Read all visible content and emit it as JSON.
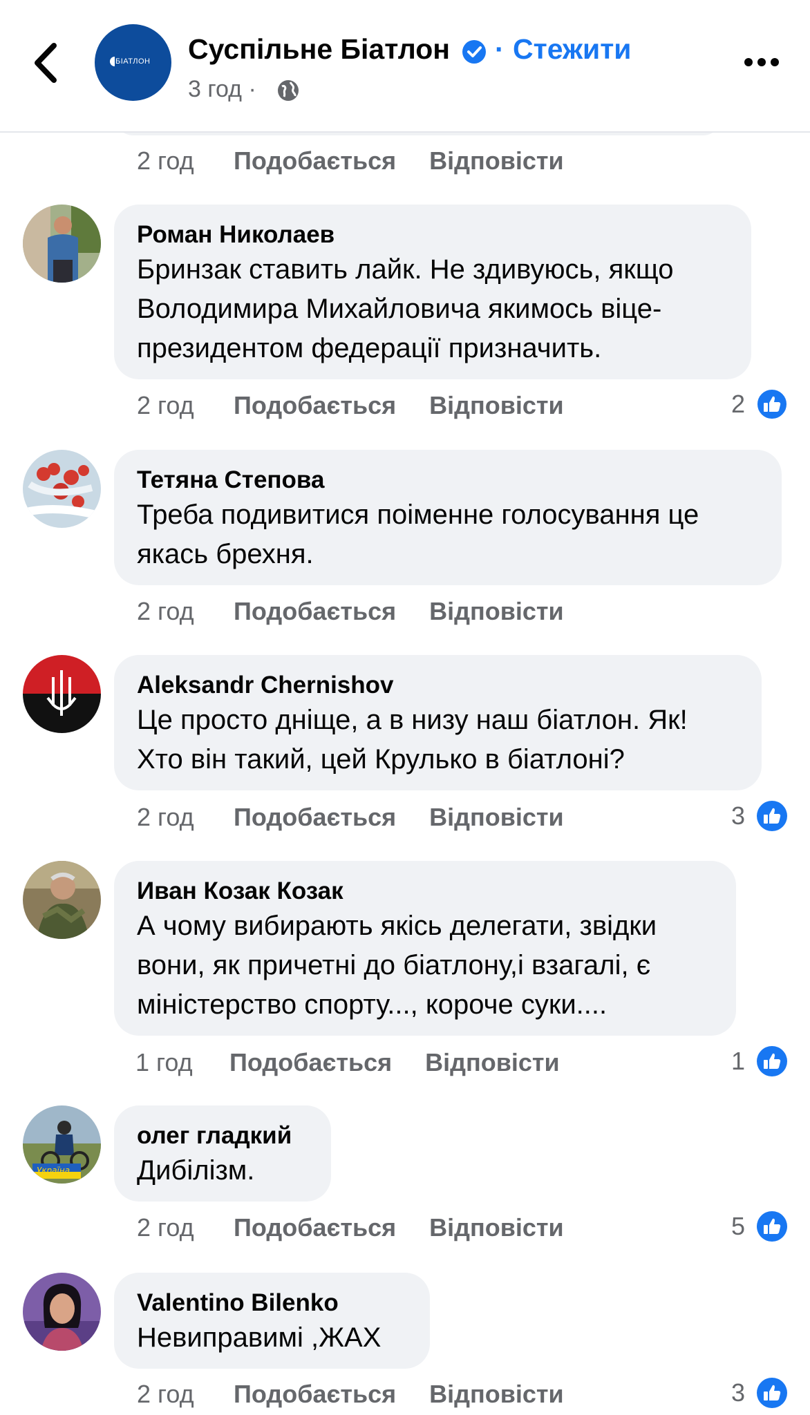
{
  "header": {
    "page_name": "Суспільне Біатлон",
    "separator": "·",
    "follow_label": "Стежити",
    "post_time": "3 год ·",
    "avatar_logo_text": "БІАТЛОН"
  },
  "prev_comment_meta": {
    "time": "2 год",
    "like_label": "Подобається",
    "reply_label": "Відповісти"
  },
  "comments": [
    {
      "author": "Роман Николаев",
      "lines": [
        "Бринзак ставить лайк. Не здивуюсь, якщо",
        "Володимира Михайловича якимось віце-",
        "президентом федерації призначить."
      ],
      "time": "2 год",
      "like_label": "Подобається",
      "reply_label": "Відповісти",
      "reactions": "2"
    },
    {
      "author": "Тетяна Степова",
      "lines": [
        "Треба подивитися поіменне голосування це",
        "якась брехня."
      ],
      "time": "2 год",
      "like_label": "Подобається",
      "reply_label": "Відповісти",
      "reactions": ""
    },
    {
      "author": "Aleksandr Chernishov",
      "lines": [
        "Це просто дніще, а в низу наш біатлон. Як!",
        "Хто він такий, цей Крулько в біатлоні?"
      ],
      "time": "2 год",
      "like_label": "Подобається",
      "reply_label": "Відповісти",
      "reactions": "3"
    },
    {
      "author": "Иван Козак Козак",
      "lines": [
        "А чому вибирають якісь делегати, звідки",
        "вони, як причетні до біатлону,і взагалі, є",
        "міністерство спорту..., короче суки...."
      ],
      "time": "1 год",
      "like_label": "Подобається",
      "reply_label": "Відповісти",
      "reactions": "1"
    },
    {
      "author": "олег гладкий",
      "lines": [
        "Дибілізм."
      ],
      "time": "2 год",
      "like_label": "Подобається",
      "reply_label": "Відповісти",
      "reactions": "5",
      "avatar_text": "Україна"
    },
    {
      "author": "Valentino Bilenko",
      "lines": [
        "Невиправимі ,ЖАХ"
      ],
      "time": "2 год",
      "like_label": "Подобається",
      "reply_label": "Відповісти",
      "reactions": "3"
    }
  ],
  "colors": {
    "accent": "#1877f2",
    "bubble": "#f0f2f5",
    "muted": "#65676b"
  },
  "icons": [
    "back-icon",
    "verified-icon",
    "globe-icon",
    "more-icon",
    "like-reaction-icon"
  ]
}
